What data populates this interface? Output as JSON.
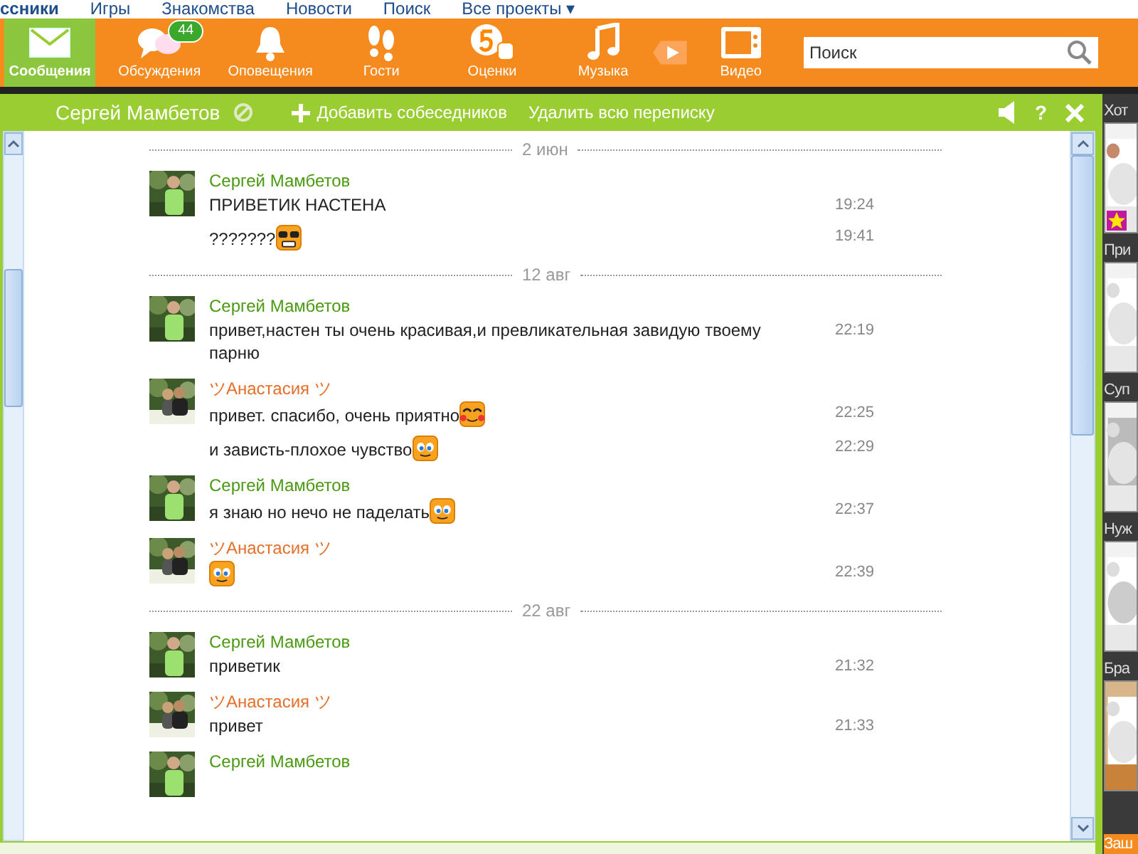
{
  "top_links": [
    {
      "label": "ссники",
      "selected": true
    },
    {
      "label": "Игры",
      "selected": false
    },
    {
      "label": "Знакомства",
      "selected": false
    },
    {
      "label": "Новости",
      "selected": false
    },
    {
      "label": "Поиск",
      "selected": false
    },
    {
      "label": "Все проекты ▾",
      "selected": false
    }
  ],
  "nav": [
    {
      "label": "Сообщения",
      "kind": "envelope",
      "selected": true
    },
    {
      "label": "Обсуждения",
      "kind": "bubbles",
      "selected": false,
      "badge": "44"
    },
    {
      "label": "Оповещения",
      "kind": "bell",
      "selected": false
    },
    {
      "label": "Гости",
      "kind": "feet",
      "selected": false
    },
    {
      "label": "Оценки",
      "kind": "rating",
      "selected": false
    },
    {
      "label": "Музыка",
      "kind": "music",
      "selected": false
    },
    {
      "label": "Видео",
      "kind": "video",
      "selected": false
    }
  ],
  "search": {
    "placeholder": "Поиск"
  },
  "chat_header": {
    "contact": "Сергей Мамбетов",
    "add_label": "Добавить собеседников",
    "delete_label": "Удалить всю переписку",
    "help": "?"
  },
  "groups": [
    {
      "date": "2 июн",
      "messages": [
        {
          "author": "Сергей Мамбетов",
          "kind": "contact",
          "lines": [
            {
              "text": "ПРИВЕТИК НАСТЕНА",
              "time": "19:24"
            },
            {
              "text": "???????",
              "kind": "cool",
              "time": "19:41"
            }
          ]
        }
      ]
    },
    {
      "date": "12 авг",
      "messages": [
        {
          "author": "Сергей Мамбетов",
          "kind": "contact",
          "lines": [
            {
              "text": "привет,настен ты очень красивая,и превликательная завидую твоему парню",
              "time": "22:19"
            }
          ]
        },
        {
          "author": "ツАнастасия ツ",
          "kind": "me",
          "lines": [
            {
              "text": "привет. спасибо, очень приятно",
              "kind": "blush",
              "time": "22:25"
            },
            {
              "text": "и зависть-плохое чувство",
              "kind": "eyes",
              "time": "22:29"
            }
          ]
        },
        {
          "author": "Сергей Мамбетов",
          "kind": "contact",
          "lines": [
            {
              "text": "я знаю но нечо не паделать",
              "kind": "eyes",
              "time": "22:37"
            }
          ]
        },
        {
          "author": "ツАнастасия ツ",
          "kind": "me",
          "lines": [
            {
              "kind": "eyes",
              "time": "22:39"
            }
          ]
        }
      ]
    },
    {
      "date": "22 авг",
      "messages": [
        {
          "author": "Сергей Мамбетов",
          "kind": "contact",
          "lines": [
            {
              "text": "приветик",
              "time": "21:32"
            }
          ]
        },
        {
          "author": "ツАнастасия ツ",
          "kind": "me",
          "lines": [
            {
              "text": "привет",
              "time": "21:33"
            }
          ]
        },
        {
          "author": "Сергей Мамбетов",
          "kind": "contact"
        }
      ]
    }
  ],
  "sidebar": {
    "items": [
      {
        "label": "Хот",
        "starred": true
      },
      {
        "label": "При",
        "starred": false
      },
      {
        "label": "Суп",
        "starred": false
      },
      {
        "label": "Нуж",
        "starred": false
      },
      {
        "label": "Бра",
        "starred": false
      }
    ],
    "promo": "Заш"
  }
}
